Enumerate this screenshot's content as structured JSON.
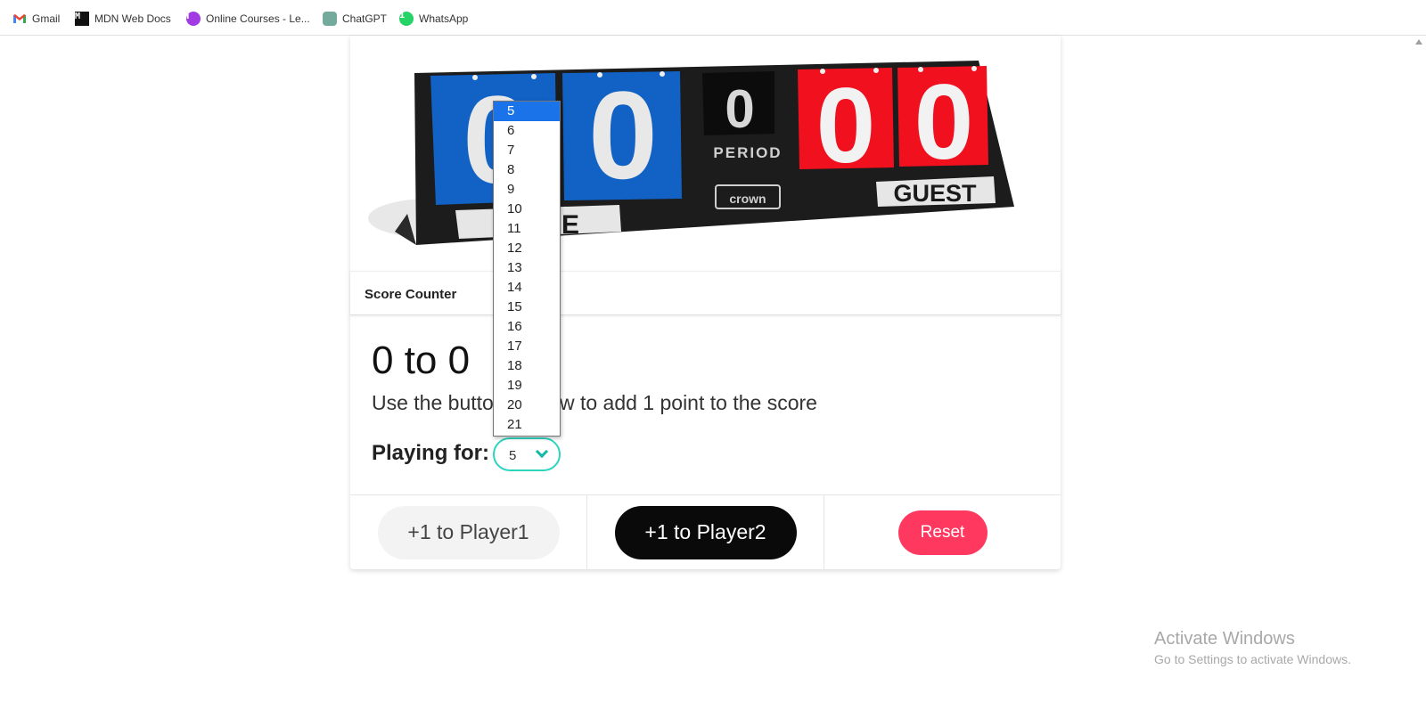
{
  "browser": {
    "bookmarks": [
      {
        "label": "Gmail",
        "icon": "gmail-icon"
      },
      {
        "label": "MDN Web Docs",
        "icon": "mdn-icon"
      },
      {
        "label": "Online Courses - Le...",
        "icon": "online-courses-icon"
      },
      {
        "label": "ChatGPT",
        "icon": "chatgpt-icon"
      },
      {
        "label": "WhatsApp",
        "icon": "whatsapp-icon"
      }
    ]
  },
  "scoreboard_image": {
    "home_label": "HOME",
    "guest_label": "GUEST",
    "period_label": "PERIOD",
    "brand": "crown",
    "home_digits": [
      "0",
      "0"
    ],
    "guest_digits": [
      "0",
      "0"
    ],
    "period_digit": "0",
    "colors": {
      "home": "#1162c4",
      "guest": "#f0101e",
      "board": "#1c1c1c"
    }
  },
  "card": {
    "header_title": "Score Counter",
    "score_text": "0 to 0",
    "subtitle": "Use the buttons below to add 1 point to the score",
    "playing_label": "Playing for:",
    "select": {
      "value": "5",
      "options": [
        "5",
        "6",
        "7",
        "8",
        "9",
        "10",
        "11",
        "12",
        "13",
        "14",
        "15",
        "16",
        "17",
        "18",
        "19",
        "20",
        "21"
      ],
      "highlighted": "5"
    },
    "buttons": {
      "player1": "+1 to Player1",
      "player2": "+1 to Player2",
      "reset": "Reset"
    }
  },
  "colors": {
    "accent": "#2dd4bf",
    "reset": "#ff3860",
    "player2_bg": "#0a0a0a",
    "highlight": "#1a73e8"
  },
  "watermark": {
    "title": "Activate Windows",
    "subtitle": "Go to Settings to activate Windows."
  }
}
